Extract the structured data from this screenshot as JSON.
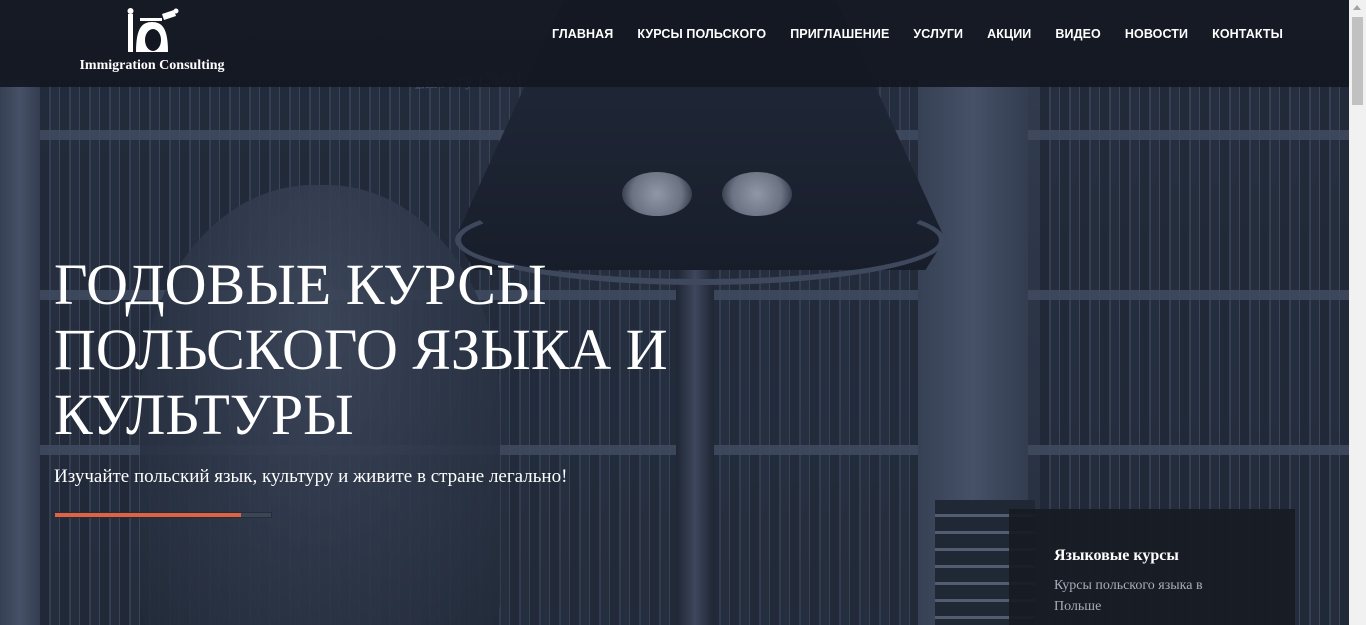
{
  "header": {
    "logo_text": "Immigration Consulting",
    "nav": [
      {
        "label": "ГЛАВНАЯ"
      },
      {
        "label": "КУРСЫ ПОЛЬСКОГО"
      },
      {
        "label": "ПРИГЛАШЕНИЕ"
      },
      {
        "label": "УСЛУГИ"
      },
      {
        "label": "АКЦИИ"
      },
      {
        "label": "ВИДЕО"
      },
      {
        "label": "НОВОСТИ"
      },
      {
        "label": "КОНТАКТЫ"
      }
    ]
  },
  "hero": {
    "sign_text": "Library Catal",
    "title": "ГОДОВЫЕ КУРСЫ ПОЛЬСКОГО ЯЗЫКА И КУЛЬТУРЫ",
    "subtitle": "Изучайте польский язык, культуру и живите в стране легально!",
    "slider_progress_percent": 86,
    "accent_color": "#e06244"
  },
  "card": {
    "title": "Языковые курсы",
    "text": "Курсы польского языка в Польше"
  }
}
